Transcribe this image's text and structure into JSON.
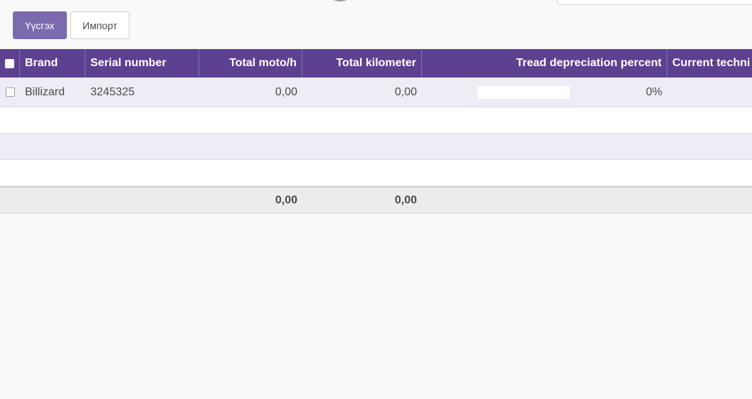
{
  "toolbar": {
    "create_label": "Үүсгэх",
    "import_label": "Импорт"
  },
  "table": {
    "columns": [
      "Brand",
      "Serial number",
      "Total moto/h",
      "Total kilometer",
      "Tread depreciation percent",
      "Current techni"
    ],
    "rows": [
      {
        "brand": "Billizard",
        "serial_number": "3245325",
        "total_moto_h": "0,00",
        "total_kilometer": "0,00",
        "tread_depreciation_percent": "0%",
        "tread_depreciation_fraction": 0,
        "current_technician": ""
      }
    ],
    "totals": {
      "total_moto_h": "0,00",
      "total_kilometer": "0,00"
    }
  },
  "colors": {
    "brand": "#5c4191",
    "accent": "#7c6aae",
    "row_tint": "#efecf6"
  }
}
